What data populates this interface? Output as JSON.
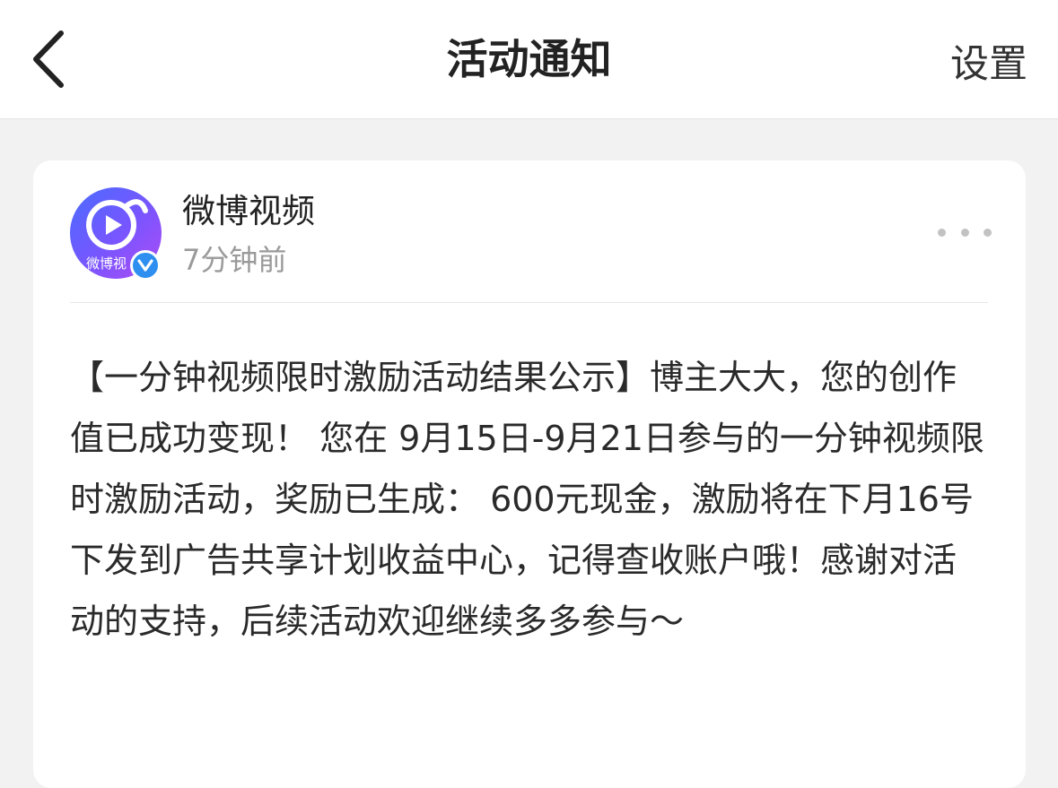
{
  "nav": {
    "title": "活动通知",
    "settings_label": "设置"
  },
  "notification": {
    "sender": "微博视频",
    "avatar_text": "微博视",
    "time": "7分钟前",
    "message": "【一分钟视频限时激励活动结果公示】博主大大，您的创作值已成功变现！ 您在 9月15日-9月21日参与的一分钟视频限时激励活动，奖励已生成： 600元现金，激励将在下月16号下发到广告共享计划收益中心，记得查收账户哦！感谢对活动的支持，后续活动欢迎继续多多参与～"
  },
  "icons": {
    "back": "chevron-left-icon",
    "avatar_logo": "play-icon",
    "verified": "verified-badge-icon",
    "more": "more-dots-icon"
  },
  "colors": {
    "background": "#f2f2f2",
    "card": "#ffffff",
    "avatar_gradient_start": "#4a6cff",
    "avatar_gradient_end": "#b04cf3",
    "verified_blue": "#2f8ff0"
  }
}
